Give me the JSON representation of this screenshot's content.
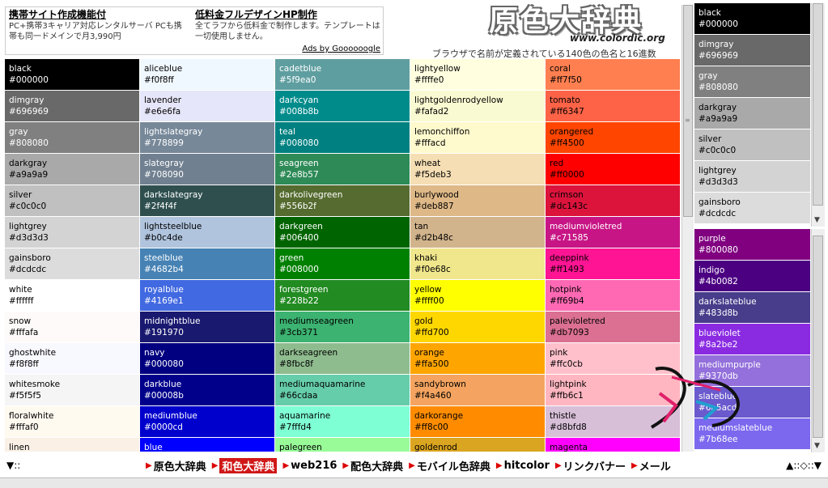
{
  "ads": [
    {
      "title": "携帯サイト作成機能付",
      "text": "PC+携帯3キャリア対応レンタルサーバ PCも携帯も同一ドメインで月3,990円"
    },
    {
      "title": "低料金フルデザインHP制作",
      "text": "全てラフから低料金で制作します。テンプレートは一切使用しません。"
    }
  ],
  "ads_by": "Ads by Goooooogle",
  "logo": {
    "jp": "原色大辞典",
    "url": "www.colordic.org"
  },
  "subtitle": "ブラウザで名前が定義されている140色の色名と16進数",
  "columns": [
    [
      {
        "name": "black",
        "hex": "#000000",
        "bg": "#000000",
        "fg": "#ffffff"
      },
      {
        "name": "dimgray",
        "hex": "#696969",
        "bg": "#696969",
        "fg": "#ffffff"
      },
      {
        "name": "gray",
        "hex": "#808080",
        "bg": "#808080",
        "fg": "#ffffff"
      },
      {
        "name": "darkgray",
        "hex": "#a9a9a9",
        "bg": "#a9a9a9",
        "fg": "#000000"
      },
      {
        "name": "silver",
        "hex": "#c0c0c0",
        "bg": "#c0c0c0",
        "fg": "#000000"
      },
      {
        "name": "lightgrey",
        "hex": "#d3d3d3",
        "bg": "#d3d3d3",
        "fg": "#000000"
      },
      {
        "name": "gainsboro",
        "hex": "#dcdcdc",
        "bg": "#dcdcdc",
        "fg": "#000000"
      },
      {
        "name": "white",
        "hex": "#ffffff",
        "bg": "#ffffff",
        "fg": "#000000"
      },
      {
        "name": "snow",
        "hex": "#fffafa",
        "bg": "#fffafa",
        "fg": "#000000"
      },
      {
        "name": "ghostwhite",
        "hex": "#f8f8ff",
        "bg": "#f8f8ff",
        "fg": "#000000"
      },
      {
        "name": "whitesmoke",
        "hex": "#f5f5f5",
        "bg": "#f5f5f5",
        "fg": "#000000"
      },
      {
        "name": "floralwhite",
        "hex": "#fffaf0",
        "bg": "#fffaf0",
        "fg": "#000000"
      },
      {
        "name": "linen",
        "hex": "",
        "bg": "#faf0e6",
        "fg": "#000000"
      }
    ],
    [
      {
        "name": "aliceblue",
        "hex": "#f0f8ff",
        "bg": "#f0f8ff",
        "fg": "#000000"
      },
      {
        "name": "lavender",
        "hex": "#e6e6fa",
        "bg": "#e6e6fa",
        "fg": "#000000"
      },
      {
        "name": "lightslategray",
        "hex": "#778899",
        "bg": "#778899",
        "fg": "#ffffff"
      },
      {
        "name": "slategray",
        "hex": "#708090",
        "bg": "#708090",
        "fg": "#ffffff"
      },
      {
        "name": "darkslategray",
        "hex": "#2f4f4f",
        "bg": "#2f4f4f",
        "fg": "#ffffff"
      },
      {
        "name": "lightsteelblue",
        "hex": "#b0c4de",
        "bg": "#b0c4de",
        "fg": "#000000"
      },
      {
        "name": "steelblue",
        "hex": "#4682b4",
        "bg": "#4682b4",
        "fg": "#ffffff"
      },
      {
        "name": "royalblue",
        "hex": "#4169e1",
        "bg": "#4169e1",
        "fg": "#ffffff"
      },
      {
        "name": "midnightblue",
        "hex": "#191970",
        "bg": "#191970",
        "fg": "#ffffff"
      },
      {
        "name": "navy",
        "hex": "#000080",
        "bg": "#000080",
        "fg": "#ffffff"
      },
      {
        "name": "darkblue",
        "hex": "#00008b",
        "bg": "#00008b",
        "fg": "#ffffff"
      },
      {
        "name": "mediumblue",
        "hex": "#0000cd",
        "bg": "#0000cd",
        "fg": "#ffffff"
      },
      {
        "name": "blue",
        "hex": "",
        "bg": "#0000ff",
        "fg": "#ffffff"
      }
    ],
    [
      {
        "name": "cadetblue",
        "hex": "#5f9ea0",
        "bg": "#5f9ea0",
        "fg": "#ffffff"
      },
      {
        "name": "darkcyan",
        "hex": "#008b8b",
        "bg": "#008b8b",
        "fg": "#ffffff"
      },
      {
        "name": "teal",
        "hex": "#008080",
        "bg": "#008080",
        "fg": "#ffffff"
      },
      {
        "name": "seagreen",
        "hex": "#2e8b57",
        "bg": "#2e8b57",
        "fg": "#ffffff"
      },
      {
        "name": "darkolivegreen",
        "hex": "#556b2f",
        "bg": "#556b2f",
        "fg": "#ffffff"
      },
      {
        "name": "darkgreen",
        "hex": "#006400",
        "bg": "#006400",
        "fg": "#ffffff"
      },
      {
        "name": "green",
        "hex": "#008000",
        "bg": "#008000",
        "fg": "#ffffff"
      },
      {
        "name": "forestgreen",
        "hex": "#228b22",
        "bg": "#228b22",
        "fg": "#ffffff"
      },
      {
        "name": "mediumseagreen",
        "hex": "#3cb371",
        "bg": "#3cb371",
        "fg": "#000000"
      },
      {
        "name": "darkseagreen",
        "hex": "#8fbc8f",
        "bg": "#8fbc8f",
        "fg": "#000000"
      },
      {
        "name": "mediumaquamarine",
        "hex": "#66cdaa",
        "bg": "#66cdaa",
        "fg": "#000000"
      },
      {
        "name": "aquamarine",
        "hex": "#7fffd4",
        "bg": "#7fffd4",
        "fg": "#000000"
      },
      {
        "name": "palegreen",
        "hex": "",
        "bg": "#98fb98",
        "fg": "#000000"
      }
    ],
    [
      {
        "name": "lightyellow",
        "hex": "#ffffe0",
        "bg": "#ffffe0",
        "fg": "#000000"
      },
      {
        "name": "lightgoldenrodyellow",
        "hex": "#fafad2",
        "bg": "#fafad2",
        "fg": "#000000"
      },
      {
        "name": "lemonchiffon",
        "hex": "#fffacd",
        "bg": "#fffacd",
        "fg": "#000000"
      },
      {
        "name": "wheat",
        "hex": "#f5deb3",
        "bg": "#f5deb3",
        "fg": "#000000"
      },
      {
        "name": "burlywood",
        "hex": "#deb887",
        "bg": "#deb887",
        "fg": "#000000"
      },
      {
        "name": "tan",
        "hex": "#d2b48c",
        "bg": "#d2b48c",
        "fg": "#000000"
      },
      {
        "name": "khaki",
        "hex": "#f0e68c",
        "bg": "#f0e68c",
        "fg": "#000000"
      },
      {
        "name": "yellow",
        "hex": "#ffff00",
        "bg": "#ffff00",
        "fg": "#000000"
      },
      {
        "name": "gold",
        "hex": "#ffd700",
        "bg": "#ffd700",
        "fg": "#000000"
      },
      {
        "name": "orange",
        "hex": "#ffa500",
        "bg": "#ffa500",
        "fg": "#000000"
      },
      {
        "name": "sandybrown",
        "hex": "#f4a460",
        "bg": "#f4a460",
        "fg": "#000000"
      },
      {
        "name": "darkorange",
        "hex": "#ff8c00",
        "bg": "#ff8c00",
        "fg": "#000000"
      },
      {
        "name": "goldenrod",
        "hex": "",
        "bg": "#daa520",
        "fg": "#000000"
      }
    ],
    [
      {
        "name": "coral",
        "hex": "#ff7f50",
        "bg": "#ff7f50",
        "fg": "#000000"
      },
      {
        "name": "tomato",
        "hex": "#ff6347",
        "bg": "#ff6347",
        "fg": "#000000"
      },
      {
        "name": "orangered",
        "hex": "#ff4500",
        "bg": "#ff4500",
        "fg": "#000000"
      },
      {
        "name": "red",
        "hex": "#ff0000",
        "bg": "#ff0000",
        "fg": "#000000"
      },
      {
        "name": "crimson",
        "hex": "#dc143c",
        "bg": "#dc143c",
        "fg": "#000000"
      },
      {
        "name": "mediumvioletred",
        "hex": "#c71585",
        "bg": "#c71585",
        "fg": "#ffffff"
      },
      {
        "name": "deeppink",
        "hex": "#ff1493",
        "bg": "#ff1493",
        "fg": "#000000"
      },
      {
        "name": "hotpink",
        "hex": "#ff69b4",
        "bg": "#ff69b4",
        "fg": "#000000"
      },
      {
        "name": "palevioletred",
        "hex": "#db7093",
        "bg": "#db7093",
        "fg": "#000000"
      },
      {
        "name": "pink",
        "hex": "#ffc0cb",
        "bg": "#ffc0cb",
        "fg": "#000000"
      },
      {
        "name": "lightpink",
        "hex": "#ffb6c1",
        "bg": "#ffb6c1",
        "fg": "#000000"
      },
      {
        "name": "thistle",
        "hex": "#d8bfd8",
        "bg": "#d8bfd8",
        "fg": "#000000"
      },
      {
        "name": "magenta",
        "hex": "",
        "bg": "#ff00ff",
        "fg": "#000000"
      }
    ]
  ],
  "side_top": [
    {
      "name": "black",
      "hex": "#000000",
      "bg": "#000000",
      "fg": "#ffffff"
    },
    {
      "name": "dimgray",
      "hex": "#696969",
      "bg": "#696969",
      "fg": "#ffffff"
    },
    {
      "name": "gray",
      "hex": "#808080",
      "bg": "#808080",
      "fg": "#ffffff"
    },
    {
      "name": "darkgray",
      "hex": "#a9a9a9",
      "bg": "#a9a9a9",
      "fg": "#000000"
    },
    {
      "name": "silver",
      "hex": "#c0c0c0",
      "bg": "#c0c0c0",
      "fg": "#000000"
    },
    {
      "name": "lightgrey",
      "hex": "#d3d3d3",
      "bg": "#d3d3d3",
      "fg": "#000000"
    },
    {
      "name": "gainsboro",
      "hex": "#dcdcdc",
      "bg": "#dcdcdc",
      "fg": "#000000"
    }
  ],
  "side_bottom": [
    {
      "name": "purple",
      "hex": "#800080",
      "bg": "#800080",
      "fg": "#ffffff"
    },
    {
      "name": "indigo",
      "hex": "#4b0082",
      "bg": "#4b0082",
      "fg": "#ffffff"
    },
    {
      "name": "darkslateblue",
      "hex": "#483d8b",
      "bg": "#483d8b",
      "fg": "#ffffff"
    },
    {
      "name": "blueviolet",
      "hex": "#8a2be2",
      "bg": "#8a2be2",
      "fg": "#ffffff"
    },
    {
      "name": "mediumpurple",
      "hex": "#9370db",
      "bg": "#9370db",
      "fg": "#ffffff"
    },
    {
      "name": "slateblue",
      "hex": "#6a5acd",
      "bg": "#6a5acd",
      "fg": "#ffffff"
    },
    {
      "name": "mediumslateblue",
      "hex": "#7b68ee",
      "bg": "#7b68ee",
      "fg": "#ffffff"
    }
  ],
  "footer": {
    "left": "▼::",
    "right": "▲::◇::▼",
    "nav": [
      {
        "label": "原色大辞典",
        "active": false
      },
      {
        "label": "和色大辞典",
        "active": true
      },
      {
        "label": "web216",
        "active": false
      },
      {
        "label": "配色大辞典",
        "active": false
      },
      {
        "label": "モバイル色辞典",
        "active": false
      },
      {
        "label": "hitcolor",
        "active": false
      },
      {
        "label": "リンクバナー",
        "active": false
      },
      {
        "label": "メール",
        "active": false
      }
    ]
  }
}
